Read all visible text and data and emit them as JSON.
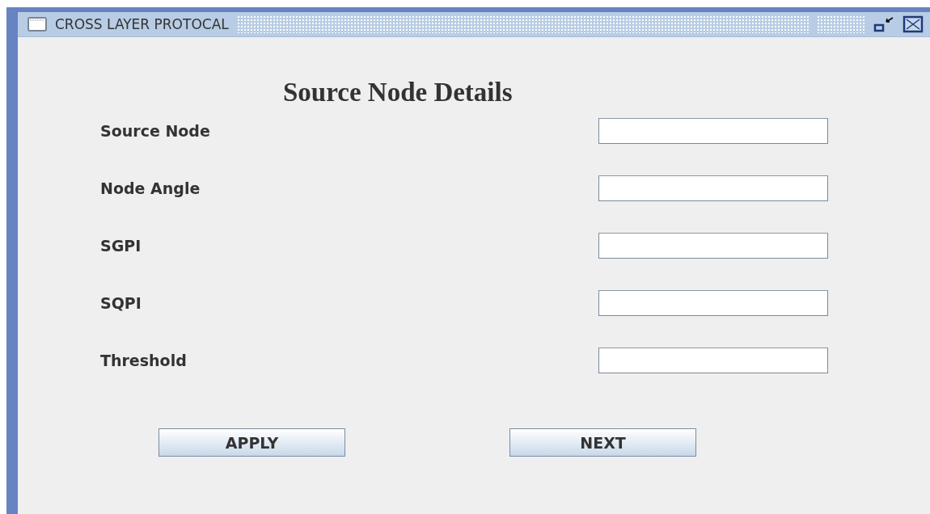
{
  "window": {
    "title": "CROSS LAYER PROTOCAL"
  },
  "heading": "Source Node Details",
  "fields": [
    {
      "label": "Source Node"
    },
    {
      "label": "Node Angle"
    },
    {
      "label": "SGPI"
    },
    {
      "label": "SQPI"
    },
    {
      "label": "Threshold"
    }
  ],
  "buttons": [
    "APPLY",
    "NEXT"
  ]
}
